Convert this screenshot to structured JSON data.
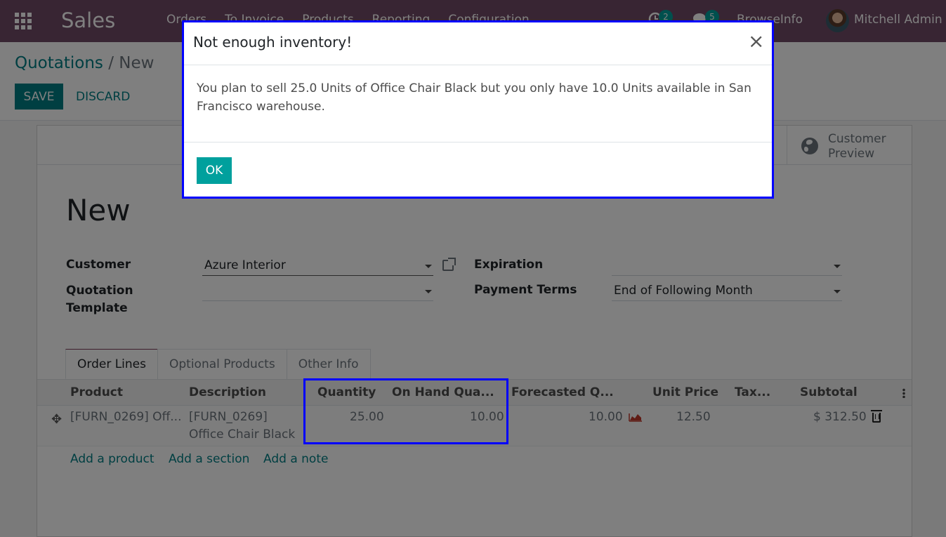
{
  "navbar": {
    "app_name": "Sales",
    "menu": [
      "Orders",
      "To Invoice",
      "Products",
      "Reporting",
      "Configuration"
    ],
    "activity_count": "2",
    "message_count": "5",
    "company": "BrowseInfo",
    "user": "Mitchell Admin"
  },
  "breadcrumb": {
    "parent": "Quotations",
    "separator": "/",
    "current": "New"
  },
  "actions": {
    "save_label": "SAVE",
    "discard_label": "DISCARD"
  },
  "smart_button": {
    "label": "Customer Preview"
  },
  "record": {
    "name": "New"
  },
  "fields": {
    "customer": {
      "label": "Customer",
      "value": "Azure Interior"
    },
    "quotation_template": {
      "label": "Quotation Template",
      "value": ""
    },
    "expiration": {
      "label": "Expiration",
      "value": ""
    },
    "payment_terms": {
      "label": "Payment Terms",
      "value": "End of Following Month"
    }
  },
  "tabs": [
    {
      "label": "Order Lines",
      "active": true
    },
    {
      "label": "Optional Products",
      "active": false
    },
    {
      "label": "Other Info",
      "active": false
    }
  ],
  "table": {
    "columns": [
      "Product",
      "Description",
      "Quantity",
      "On Hand Qua...",
      "Forecasted Q...",
      "Unit Price",
      "Tax...",
      "Subtotal"
    ],
    "rows": [
      {
        "product": "[FURN_0269] Off...",
        "description_line1": "[FURN_0269]",
        "description_line2": "Office Chair Black",
        "quantity": "25.00",
        "on_hand": "10.00",
        "forecasted": "10.00",
        "unit_price": "12.50",
        "taxes": "",
        "subtotal": "$ 312.50"
      }
    ],
    "add_links": [
      "Add a product",
      "Add a section",
      "Add a note"
    ]
  },
  "dialog": {
    "title": "Not enough inventory!",
    "message": "You plan to sell 25.0 Units of Office Chair Black but you only have 10.0 Units available in San Francisco warehouse.",
    "ok_label": "OK",
    "close_symbol": "×"
  },
  "colors": {
    "navbar": "#714b67",
    "primary": "#017e84",
    "teal": "#00a09d",
    "highlight": "#0000ff",
    "forecast_chart": "#c0392b"
  }
}
